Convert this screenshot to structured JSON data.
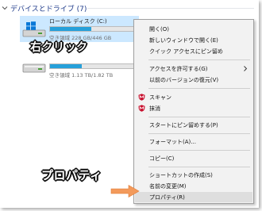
{
  "section": {
    "title": "デバイスとドライブ (7)"
  },
  "drives": [
    {
      "name": "ローカル ディスク (C:)",
      "space": "空き領域 228 GB/446 GB",
      "usage_fraction": 0.49,
      "selected": true
    },
    {
      "name": "",
      "space": "空き領域 1.13 TB/1.82 TB",
      "usage_fraction": 0.38,
      "selected": false
    }
  ],
  "annotations": {
    "right_click": "右クリック",
    "properties": "プロパティ"
  },
  "context_menu": {
    "items": [
      {
        "label": "開く(O)"
      },
      {
        "label": "新しいウィンドウで開く(E)"
      },
      {
        "label": "クイック アクセスにピン留め"
      },
      {
        "label": "アクセスを許可する(G)",
        "submenu": true
      },
      {
        "label": "以前のバージョンの復元(V)"
      },
      {
        "label": "スキャン",
        "icon": "mcafee-shield-icon"
      },
      {
        "label": "抹消",
        "icon": "mcafee-shield-icon"
      },
      {
        "label": "スタートにピン留めする(P)"
      },
      {
        "label": "フォーマット(A)..."
      },
      {
        "label": "コピー(C)"
      },
      {
        "label": "ショートカットの作成(S)"
      },
      {
        "label": "名前の変更(M)"
      },
      {
        "label": "プロパティ(R)",
        "hover": true
      }
    ]
  },
  "colors": {
    "selection": "#cce8ff",
    "usage_bar": "#26a0da",
    "mcafee_red": "#c8102e",
    "pointer_arrow": "#f39a5b"
  }
}
